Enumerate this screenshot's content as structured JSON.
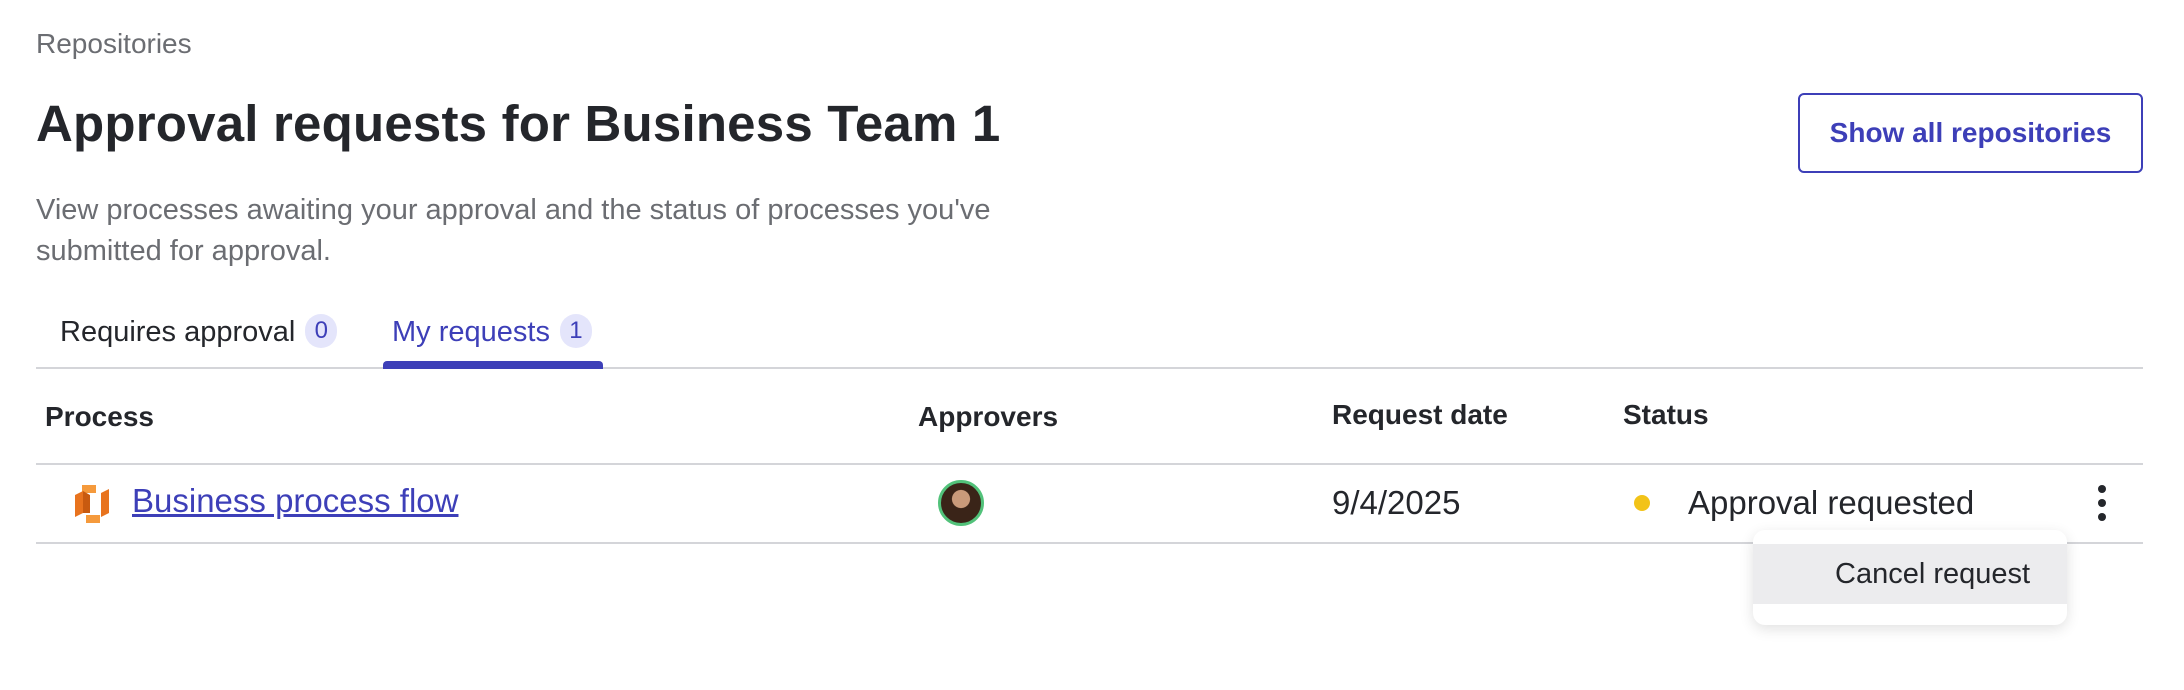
{
  "breadcrumb": "Repositories",
  "page_title": "Approval requests for Business Team 1",
  "show_all_button": "Show all repositories",
  "description": "View processes awaiting your approval and the status of processes you've submitted for approval.",
  "tabs": [
    {
      "label": "Requires approval",
      "count": "0",
      "active": false
    },
    {
      "label": "My requests",
      "count": "1",
      "active": true
    }
  ],
  "table": {
    "headers": {
      "process": "Process",
      "approvers": "Approvers",
      "request_date": "Request date",
      "status": "Status"
    },
    "rows": [
      {
        "process": "Business process flow",
        "request_date": "9/4/2025",
        "status": "Approval requested",
        "status_color": "#f2c318"
      }
    ]
  },
  "menu": {
    "items": [
      {
        "label": "Cancel request"
      }
    ]
  },
  "colors": {
    "accent": "#3d3fb8",
    "process_icon": "#e8731e",
    "avatar_ring": "#52c27a"
  }
}
